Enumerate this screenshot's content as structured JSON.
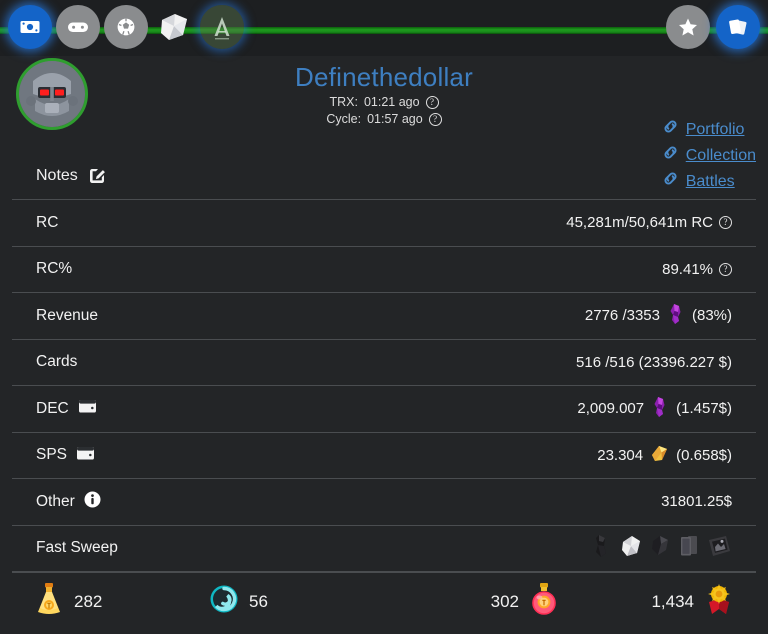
{
  "colors": {
    "page_bg": "#232527",
    "topbar_bg": "#1d1f21",
    "green_bar": "#1e9b1e",
    "accent_blue": "#1464c8",
    "title_blue": "#3e7fc1",
    "link_blue": "#4a8ccc",
    "divider": "#4a4d50",
    "avatar_ring": "#2f9e2f"
  },
  "topbar": {
    "left_icons": [
      {
        "name": "money-icon",
        "state": "active"
      },
      {
        "name": "gamepad-icon",
        "state": "inactive"
      },
      {
        "name": "soccer-ball-icon",
        "state": "inactive"
      },
      {
        "name": "scroll-icon",
        "state": "plain"
      },
      {
        "name": "arena-a-icon",
        "state": "ghost"
      }
    ],
    "right_icons": [
      {
        "name": "star-icon",
        "state": "inactive"
      },
      {
        "name": "cards-icon",
        "state": "active"
      }
    ]
  },
  "header": {
    "avatar_name": "robot-avatar",
    "username": "Definethedollar",
    "trx_label": "TRX:",
    "trx_value": "01:21 ago",
    "cycle_label": "Cycle:",
    "cycle_value": "01:57 ago",
    "help_glyph": "?",
    "links": [
      {
        "label": "Portfolio",
        "icon": "chain-link-icon"
      },
      {
        "label": "Collection",
        "icon": "chain-link-icon"
      },
      {
        "label": "Battles",
        "icon": "chain-link-icon"
      }
    ]
  },
  "notes": {
    "label": "Notes",
    "edit_icon": "edit-pencil-square-icon"
  },
  "rows": [
    {
      "id": "rc",
      "label": "RC",
      "label_icon": null,
      "value": "45,281m/50,641m RC",
      "value_icon": null,
      "suffix": null,
      "help": true
    },
    {
      "id": "rc-percent",
      "label": "RC%",
      "label_icon": null,
      "value": "89.41%",
      "value_icon": null,
      "suffix": null,
      "help": true
    },
    {
      "id": "revenue",
      "label": "Revenue",
      "label_icon": null,
      "value": "2776 /3353",
      "value_icon": "dec-token-icon",
      "suffix": "(83%)",
      "help": false
    },
    {
      "id": "cards",
      "label": "Cards",
      "label_icon": null,
      "value": "516 /516 (23396.227 $)",
      "value_icon": null,
      "suffix": null,
      "help": false
    },
    {
      "id": "dec",
      "label": "DEC",
      "label_icon": "wallet-icon",
      "value": "2,009.007",
      "value_icon": "dec-token-icon",
      "suffix": "(1.457$)",
      "help": false
    },
    {
      "id": "sps",
      "label": "SPS",
      "label_icon": "wallet-icon",
      "value": "23.304",
      "value_icon": "sps-token-icon",
      "suffix": "(0.658$)",
      "help": false
    },
    {
      "id": "other",
      "label": "Other",
      "label_icon": "info-icon",
      "value": "31801.25$",
      "value_icon": null,
      "suffix": null,
      "help": false
    }
  ],
  "fast_sweep": {
    "label": "Fast Sweep",
    "icons": [
      "dark-figure-icon",
      "white-scroll-icon",
      "dark-crystal-icon",
      "card-pack-icon",
      "framed-relic-icon"
    ]
  },
  "bottom_stats": [
    {
      "id": "gold-potion",
      "icon": "gold-potion-icon",
      "value": "282",
      "icon_first": true
    },
    {
      "id": "vortex",
      "icon": "teal-vortex-icon",
      "value": "56",
      "icon_first": true
    },
    {
      "id": "legendary-potion",
      "icon": "red-potion-icon",
      "value": "302",
      "icon_first": false
    },
    {
      "id": "guild-crest",
      "icon": "guild-crest-icon",
      "value": "1,434",
      "icon_first": false
    }
  ]
}
